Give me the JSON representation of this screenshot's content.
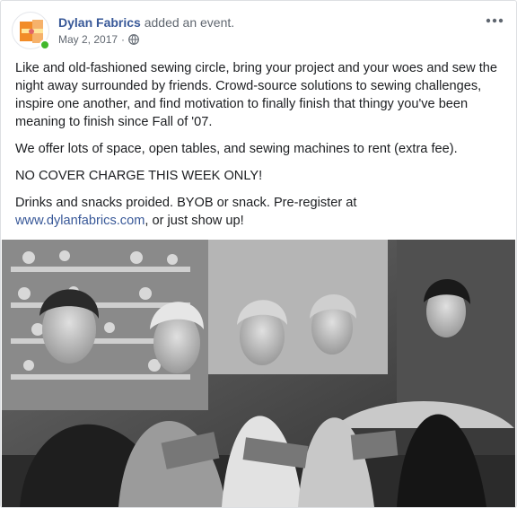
{
  "post": {
    "page_name": "Dylan Fabrics",
    "action": "added an event.",
    "date": "May 2, 2017",
    "separator": "·",
    "privacy_icon": "globe-icon",
    "more_icon": "more-options-icon",
    "paragraph1": "Like and old-fashioned sewing circle, bring your project and your woes and sew the night away surrounded by friends. Crowd-source solutions to sewing challenges, inspire one another, and find motivation to finally finish that thingy you've been meaning to finish since Fall of '07.",
    "paragraph2": "We offer lots of space, open tables, and sewing machines to rent (extra fee).",
    "paragraph3": "NO COVER CHARGE THIS WEEK ONLY!",
    "paragraph4_start": "Drinks and snacks proided. BYOB or snack. Pre-register at",
    "link": "www.dylanfabrics.com",
    "paragraph4_end": ", or just show up!"
  },
  "colors": {
    "link": "#385898",
    "presence": "#42b72a",
    "text": "#1c1e21",
    "meta": "#606770",
    "logo_orange": "#f28c28"
  }
}
